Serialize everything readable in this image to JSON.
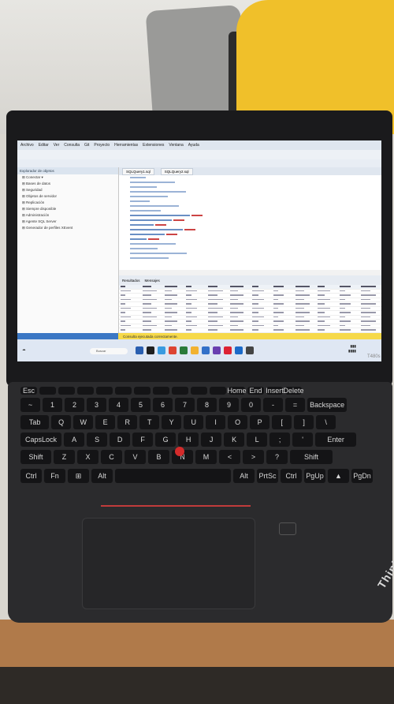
{
  "screen": {
    "menu": [
      "Archivo",
      "Editar",
      "Ver",
      "Consulta",
      "Git",
      "Proyecto",
      "Herramientas",
      "Extensiones",
      "Ventana",
      "Ayuda"
    ],
    "search_label": "Buscar",
    "object_explorer": {
      "title": "Explorador de objetos",
      "items": [
        "Conectar ▾",
        "Bases de datos",
        "Seguridad",
        "Objetos de servidor",
        "Replicación",
        "Siempre disponible",
        "Administración",
        "Agente SQL Server",
        "Generador de perfiles XEvent"
      ]
    },
    "tabs": [
      "SQLQuery1.sql",
      "SQLQuery2.sql"
    ],
    "results_tabs": [
      "Resultados",
      "Mensajes"
    ],
    "status_message": "Consulta ejecutada correctamente.",
    "taskbar_search": "Buscar"
  },
  "laptop": {
    "keys_row2": [
      "Esc",
      "",
      "",
      "",
      "",
      "",
      "",
      "",
      "",
      "",
      "",
      "Home",
      "End",
      "Insert",
      "Delete"
    ],
    "keys_row3": [
      "~",
      "1",
      "2",
      "3",
      "4",
      "5",
      "6",
      "7",
      "8",
      "9",
      "0",
      "-",
      "=",
      "Backspace"
    ],
    "keys_row4": [
      "Tab",
      "Q",
      "W",
      "E",
      "R",
      "T",
      "Y",
      "U",
      "I",
      "O",
      "P",
      "[",
      "]",
      "\\"
    ],
    "keys_row5": [
      "CapsLock",
      "A",
      "S",
      "D",
      "F",
      "G",
      "H",
      "J",
      "K",
      "L",
      ";",
      "'",
      "Enter"
    ],
    "keys_row6": [
      "Shift",
      "Z",
      "X",
      "C",
      "V",
      "B",
      "N",
      "M",
      "<",
      ">",
      "?",
      "Shift"
    ],
    "keys_row7": [
      "Ctrl",
      "Fn",
      "⊞",
      "Alt",
      "",
      "Alt",
      "PrtSc",
      "Ctrl",
      "PgUp",
      "▲",
      "PgDn"
    ],
    "brand": "ThinkPad"
  },
  "colors": {
    "shirt": "#f0c02a",
    "trackpoint": "#d42b2b",
    "desk": "#b07a4a"
  }
}
